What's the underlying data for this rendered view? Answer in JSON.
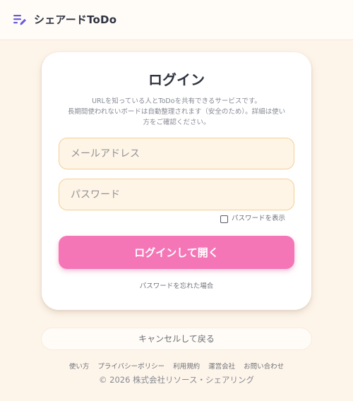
{
  "header": {
    "app_title": "シェアードToDo",
    "logo_icon": "list-pencil-icon",
    "accent_color": "#6b5bd6"
  },
  "login": {
    "title": "ログイン",
    "description_line1": "URLを知っている人とToDoを共有できるサービスです。",
    "description_line2": "長期間使われないボードは自動整理されます（安全のため）。詳細は使い",
    "description_line3": "方をご確認ください。",
    "email_placeholder": "メールアドレス",
    "email_value": "",
    "password_placeholder": "パスワード",
    "password_value": "",
    "show_password_label": "パスワードを表示",
    "show_password_checked": false,
    "submit_label": "ログインして開く",
    "submit_color": "#f476b6",
    "forgot_label": "パスワードを忘れた場合"
  },
  "cancel_label": "キャンセルして戻る",
  "footer": {
    "links": [
      "使い方",
      "プライバシーポリシー",
      "利用規約",
      "運営会社",
      "お問い合わせ"
    ],
    "copyright": "© 2026 株式会社リソース・シェアリング"
  }
}
